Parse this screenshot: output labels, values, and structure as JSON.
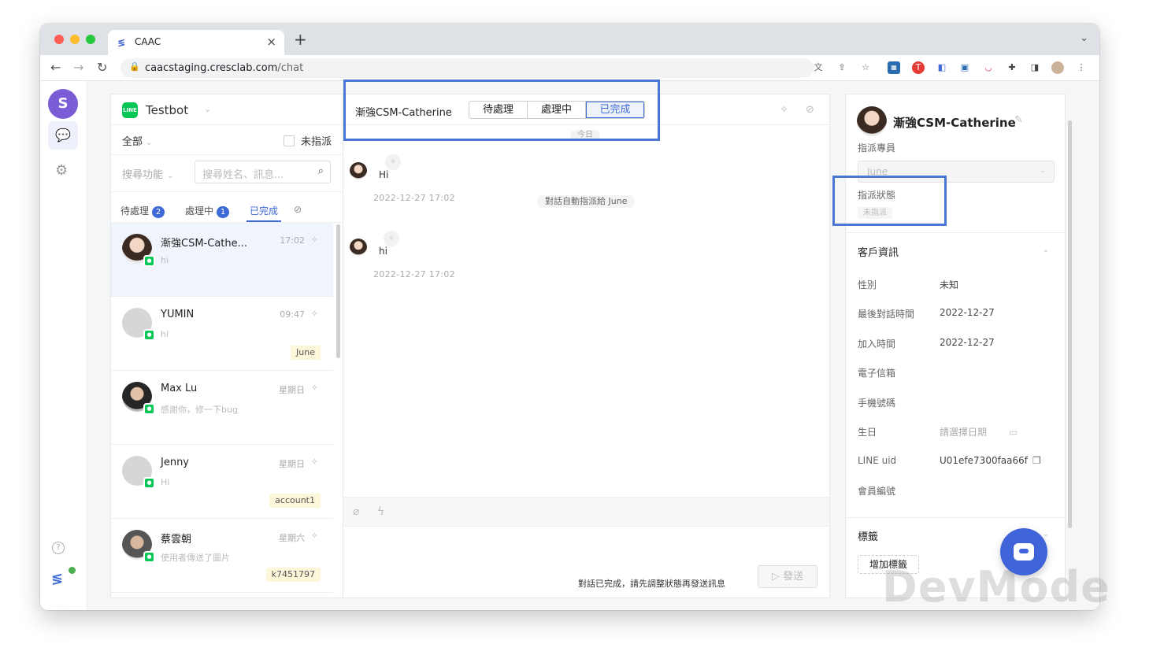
{
  "browser": {
    "tab_title": "CAAC",
    "url_host": "caacstaging.cresclab.com",
    "url_path": "/chat"
  },
  "sidebar": {
    "logo_icon": "cresclab-logo-icon",
    "items": [
      "chat-icon",
      "gear-icon"
    ],
    "help_label": "?"
  },
  "list": {
    "bot_name": "Testbot",
    "filter_label": "全部",
    "unassigned_label": "未指派",
    "search_field_label": "搜尋功能",
    "search_placeholder": "搜尋姓名、訊息...",
    "tabs": [
      {
        "label": "待處理",
        "count": "2"
      },
      {
        "label": "處理中",
        "count": "1"
      },
      {
        "label": "已完成",
        "count": ""
      }
    ],
    "conversations": [
      {
        "name": "漸強CSM-Cathe...",
        "preview": "hi",
        "time": "17:02",
        "tag": ""
      },
      {
        "name": "YUMIN",
        "preview": "hi",
        "time": "09:47",
        "tag": "June"
      },
      {
        "name": "Max Lu",
        "preview": "感謝你，修一下bug",
        "time": "星期日",
        "tag": ""
      },
      {
        "name": "Jenny",
        "preview": "Hi",
        "time": "星期日",
        "tag": "account1"
      },
      {
        "name": "蔡雲朝",
        "preview": "使用者傳送了圖片",
        "time": "星期六",
        "tag": "k7451797"
      }
    ]
  },
  "chat": {
    "contact_name": "漸強CSM-Catherine",
    "status_tabs": [
      "待處理",
      "處理中",
      "已完成"
    ],
    "active_status": "已完成",
    "today_label": "今日",
    "messages": [
      {
        "text": "Hi",
        "time": "2022-12-27 17:02"
      },
      {
        "text": "hi",
        "time": "2022-12-27 17:02"
      }
    ],
    "system_message": "對話自動指派給 June",
    "done_notice": "對話已完成，請先調整狀態再發送訊息",
    "send_label": "發送"
  },
  "info": {
    "name": "漸強CSM-Catherine",
    "assignee_label": "指派專員",
    "assignee_value": "June",
    "status_label": "指派狀態",
    "status_value": "未指派",
    "customer_section": "客戶資訊",
    "fields": [
      {
        "key": "性別",
        "value": "未知"
      },
      {
        "key": "最後對話時間",
        "value": "2022-12-27"
      },
      {
        "key": "加入時間",
        "value": "2022-12-27"
      },
      {
        "key": "電子信箱",
        "value": ""
      },
      {
        "key": "手機號碼",
        "value": ""
      },
      {
        "key": "生日",
        "value": "請選擇日期"
      },
      {
        "key": "LINE uid",
        "value": "U01efe7300faa66f"
      },
      {
        "key": "會員編號",
        "value": ""
      }
    ],
    "tags_section": "標籤",
    "add_tag_label": "增加標籤"
  },
  "watermark": "DevMode",
  "colors": {
    "accent": "#3d6ad6",
    "line_green": "#06c755",
    "highlight_box": "#4a76d6"
  }
}
